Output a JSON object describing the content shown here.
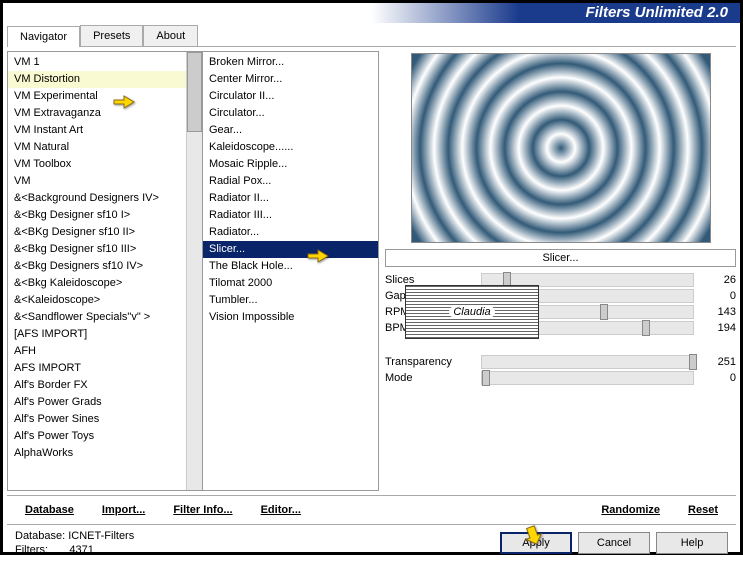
{
  "title": "Filters Unlimited 2.0",
  "tabs": [
    "Navigator",
    "Presets",
    "About"
  ],
  "activeTab": 0,
  "categories": [
    "VM 1",
    "VM Distortion",
    "VM Experimental",
    "VM Extravaganza",
    "VM Instant Art",
    "VM Natural",
    "VM Toolbox",
    "VM",
    "&<Background Designers IV>",
    "&<Bkg Designer sf10 I>",
    "&<BKg Designer sf10 II>",
    "&<Bkg Designer sf10 III>",
    "&<Bkg Designers sf10 IV>",
    "&<Bkg Kaleidoscope>",
    "&<Kaleidoscope>",
    "&<Sandflower Specials\"v\" >",
    "[AFS IMPORT]",
    "AFH",
    "AFS IMPORT",
    "Alf's Border FX",
    "Alf's Power Grads",
    "Alf's Power Sines",
    "Alf's Power Toys",
    "AlphaWorks"
  ],
  "highlightedCategory": 1,
  "filters": [
    "Broken Mirror...",
    "Center Mirror...",
    "Circulator II...",
    "Circulator...",
    "Gear...",
    "Kaleidoscope......",
    "Mosaic Ripple...",
    "Radial Pox...",
    "Radiator II...",
    "Radiator III...",
    "Radiator...",
    "Slicer...",
    "The Black Hole...",
    "Tilomat 2000",
    "Tumbler...",
    "Vision Impossible"
  ],
  "selectedFilter": 11,
  "currentFilterName": "Slicer...",
  "params": [
    {
      "label": "Slices",
      "value": 26,
      "pos": 10
    },
    {
      "label": "Gap",
      "value": 0,
      "pos": 0
    },
    {
      "label": "RPM",
      "value": 143,
      "pos": 56
    },
    {
      "label": "BPM",
      "value": 194,
      "pos": 76
    }
  ],
  "params2": [
    {
      "label": "Transparency",
      "value": 251,
      "pos": 98
    },
    {
      "label": "Mode",
      "value": 0,
      "pos": 0
    }
  ],
  "toolbar": {
    "database": "Database",
    "import": "Import...",
    "filterinfo": "Filter Info...",
    "editor": "Editor...",
    "randomize": "Randomize",
    "reset": "Reset"
  },
  "footer": {
    "db_label": "Database:",
    "db_value": "ICNET-Filters",
    "filters_label": "Filters:",
    "filters_value": "4371",
    "apply": "Apply",
    "cancel": "Cancel",
    "help": "Help"
  },
  "watermark": "Claudia"
}
